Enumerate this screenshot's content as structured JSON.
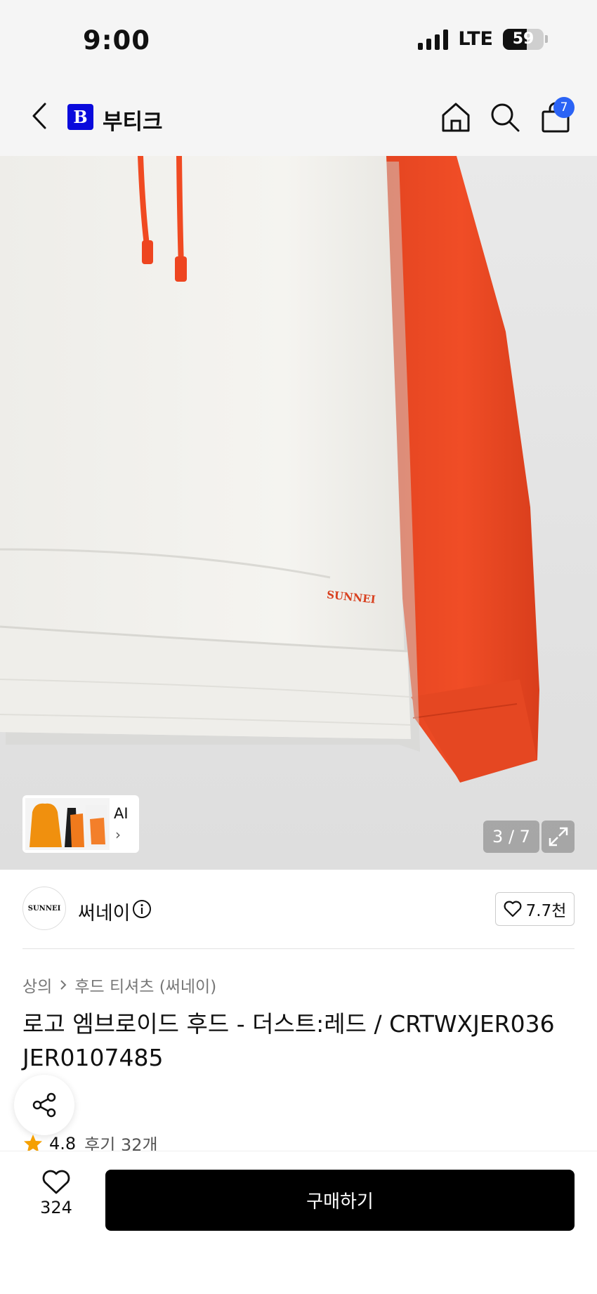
{
  "status_bar": {
    "time": "9:00",
    "network": "LTE",
    "battery": "59",
    "battery_level": 0.59
  },
  "header": {
    "brand_logo_letter": "B",
    "brand_name": "부티크",
    "cart_count": "7"
  },
  "gallery": {
    "counter": "3 / 7",
    "ai_label": "AI",
    "ai_chevron": "›",
    "print_logo": "SUNNEI",
    "colors": {
      "body": "#f3f2ee",
      "sleeve": "#ef4a24",
      "drawstring": "#f04a22",
      "background": "#e6e6e6"
    }
  },
  "brand": {
    "logo_text": "SUNNEI",
    "name": "써네이",
    "likes": "7.7천"
  },
  "product": {
    "breadcrumb": [
      "상의",
      "후드 티셔츠 (써네이)"
    ],
    "title": "로고 엠브로이드 후드 - 더스트:레드 / CRTWXJER036 JER0107485",
    "rating": "4.8",
    "reviews": "후기 32개",
    "star_color": "#f5a000"
  },
  "bottom_bar": {
    "wish_count": "324",
    "buy_label": "구매하기"
  }
}
